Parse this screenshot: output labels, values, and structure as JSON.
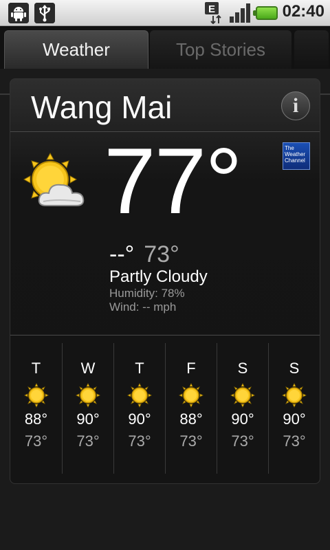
{
  "status_bar": {
    "time": "02:40",
    "network_type": "E",
    "icons": [
      "android-debug-icon",
      "usb-icon",
      "edge-data-icon",
      "signal-icon",
      "battery-icon"
    ]
  },
  "tabs": [
    {
      "label": "Weather",
      "selected": true
    },
    {
      "label": "Top Stories",
      "selected": false
    }
  ],
  "location": {
    "city": "Wang Mai"
  },
  "current": {
    "temp": "77°",
    "high": "--°",
    "low": "73°",
    "condition": "Partly Cloudy",
    "humidity": "Humidity: 78%",
    "wind": "Wind: -- mph",
    "icon": "partly-cloudy-icon"
  },
  "provider": {
    "name": "The Weather Channel",
    "logo_lines": [
      "The",
      "Weather",
      "Channel"
    ]
  },
  "forecast": [
    {
      "day": "T",
      "high": "88°",
      "low": "73°",
      "icon": "sunny-icon"
    },
    {
      "day": "W",
      "high": "90°",
      "low": "73°",
      "icon": "sunny-icon"
    },
    {
      "day": "T",
      "high": "90°",
      "low": "73°",
      "icon": "sunny-icon"
    },
    {
      "day": "F",
      "high": "88°",
      "low": "73°",
      "icon": "sunny-icon"
    },
    {
      "day": "S",
      "high": "90°",
      "low": "73°",
      "icon": "sunny-icon"
    },
    {
      "day": "S",
      "high": "90°",
      "low": "73°",
      "icon": "sunny-icon"
    }
  ],
  "colors": {
    "sun": "#f7c51c",
    "battery": "#6cc83a",
    "logo_blue": "#1a4fb4"
  }
}
